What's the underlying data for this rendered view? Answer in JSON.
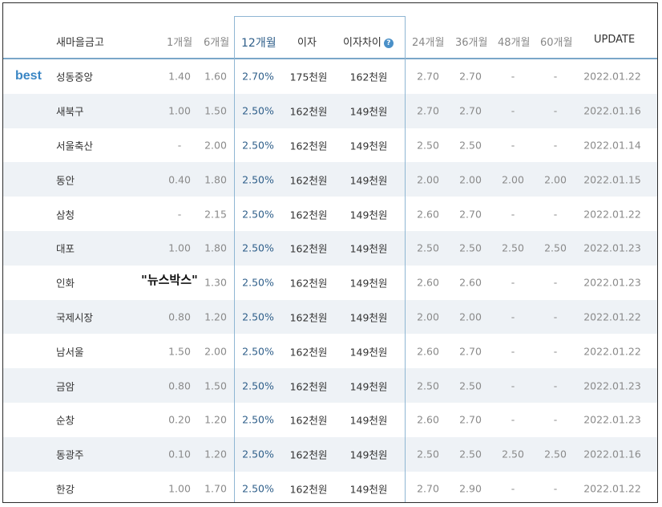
{
  "header": {
    "name": "새마을금고",
    "m1": "1개월",
    "m6": "6개월",
    "m12": "12개월",
    "interest": "이자",
    "interest_diff": "이자차이",
    "help_icon": "?",
    "m24": "24개월",
    "m36": "36개월",
    "m48": "48개월",
    "m60": "60개월",
    "update": "UPDATE"
  },
  "best_label": "best",
  "watermark": "\"뉴스박스\"",
  "rows": [
    {
      "name": "성동중앙",
      "m1": "1.40",
      "m6": "1.60",
      "m12": "2.70%",
      "interest": "175천원",
      "diff": "162천원",
      "m24": "2.70",
      "m36": "2.70",
      "m48": "-",
      "m60": "-",
      "update": "2022.01.22"
    },
    {
      "name": "새북구",
      "m1": "1.00",
      "m6": "1.50",
      "m12": "2.50%",
      "interest": "162천원",
      "diff": "149천원",
      "m24": "2.70",
      "m36": "2.70",
      "m48": "-",
      "m60": "-",
      "update": "2022.01.16"
    },
    {
      "name": "서울축산",
      "m1": "-",
      "m6": "2.00",
      "m12": "2.50%",
      "interest": "162천원",
      "diff": "149천원",
      "m24": "2.50",
      "m36": "2.50",
      "m48": "-",
      "m60": "-",
      "update": "2022.01.14"
    },
    {
      "name": "동안",
      "m1": "0.40",
      "m6": "1.80",
      "m12": "2.50%",
      "interest": "162천원",
      "diff": "149천원",
      "m24": "2.00",
      "m36": "2.00",
      "m48": "2.00",
      "m60": "2.00",
      "update": "2022.01.15"
    },
    {
      "name": "삼청",
      "m1": "-",
      "m6": "2.15",
      "m12": "2.50%",
      "interest": "162천원",
      "diff": "149천원",
      "m24": "2.60",
      "m36": "2.70",
      "m48": "-",
      "m60": "-",
      "update": "2022.01.22"
    },
    {
      "name": "대포",
      "m1": "1.00",
      "m6": "1.80",
      "m12": "2.50%",
      "interest": "162천원",
      "diff": "149천원",
      "m24": "2.50",
      "m36": "2.50",
      "m48": "2.50",
      "m60": "2.50",
      "update": "2022.01.23"
    },
    {
      "name": "인화",
      "m1": "",
      "m6": "1.30",
      "m12": "2.50%",
      "interest": "162천원",
      "diff": "149천원",
      "m24": "2.60",
      "m36": "2.60",
      "m48": "-",
      "m60": "-",
      "update": "2022.01.23"
    },
    {
      "name": "국제시장",
      "m1": "0.80",
      "m6": "1.20",
      "m12": "2.50%",
      "interest": "162천원",
      "diff": "149천원",
      "m24": "2.00",
      "m36": "2.00",
      "m48": "-",
      "m60": "-",
      "update": "2022.01.22"
    },
    {
      "name": "남서울",
      "m1": "1.50",
      "m6": "2.00",
      "m12": "2.50%",
      "interest": "162천원",
      "diff": "149천원",
      "m24": "2.60",
      "m36": "2.70",
      "m48": "-",
      "m60": "-",
      "update": "2022.01.22"
    },
    {
      "name": "금암",
      "m1": "0.80",
      "m6": "1.50",
      "m12": "2.50%",
      "interest": "162천원",
      "diff": "149천원",
      "m24": "2.50",
      "m36": "2.50",
      "m48": "-",
      "m60": "-",
      "update": "2022.01.23"
    },
    {
      "name": "순창",
      "m1": "0.20",
      "m6": "1.20",
      "m12": "2.50%",
      "interest": "162천원",
      "diff": "149천원",
      "m24": "2.60",
      "m36": "2.70",
      "m48": "-",
      "m60": "-",
      "update": "2022.01.23"
    },
    {
      "name": "동광주",
      "m1": "0.10",
      "m6": "1.20",
      "m12": "2.50%",
      "interest": "162천원",
      "diff": "149천원",
      "m24": "2.50",
      "m36": "2.50",
      "m48": "2.50",
      "m60": "2.50",
      "update": "2022.01.16"
    },
    {
      "name": "한강",
      "m1": "1.00",
      "m6": "1.70",
      "m12": "2.50%",
      "interest": "162천원",
      "diff": "149천원",
      "m24": "2.70",
      "m36": "2.90",
      "m48": "-",
      "m60": "-",
      "update": "2022.01.22"
    }
  ]
}
